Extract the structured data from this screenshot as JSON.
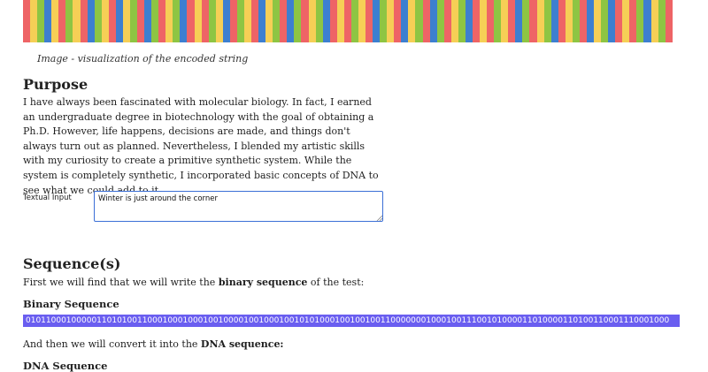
{
  "visualization": {
    "caption": "Image - visualization of the encoded string",
    "colors": {
      "yellow": "#f6cf56",
      "red": "#ee6466",
      "green": "#8ec543",
      "blue": "#3d7fd0"
    },
    "stripe_sequence": "rrryyygggbbbyyyrrrgggyyyrrrbbbgggyyyrrrbbbyyygggrrrbbbgggrrryyygggbbbrrryyyrrrgggyyybbbrrrgggyyyrrrbbbyyygggrrrbbbgggrrryyygggbbbrrryyyrrrgggyyyrrrbbbgggyyyrrrbbbyyygggrrrbbbgggrrryyygggbbbrrryyyrrrgggyyyrrrbbbgggrrryyygggbbbrrryyygggrrrbbbyyygggbbbrrryyyrrrgggbbbyyygggrrr"
  },
  "purpose": {
    "heading": "Purpose",
    "body": "I have always been fascinated with molecular biology. In fact, I earned an undergraduate degree in biotechnology with the goal of obtaining a Ph.D. However, life happens, decisions are made, and things don't always turn out as planned. Nevertheless, I blended my artistic skills with my curiosity to create a primitive synthetic system. While the system is completely synthetic, I incorporated basic concepts of DNA to see what we could add to it."
  },
  "input": {
    "label": "Textual Input",
    "value": "Winter is just around the corner"
  },
  "sequences": {
    "heading": "Sequence(s)",
    "intro_prefix": "First we will find that we will write the ",
    "intro_bold": "binary sequence",
    "intro_suffix": " of the test:",
    "binary_heading": "Binary Sequence",
    "binary_value": "0101100010000011010100110001000100010010000100100010010101000100100100110000000100010011100101000011010000110100110001110001000",
    "convert_prefix": "And then we will convert it into the ",
    "convert_bold": "DNA sequence:",
    "dna_heading": "DNA Sequence"
  }
}
